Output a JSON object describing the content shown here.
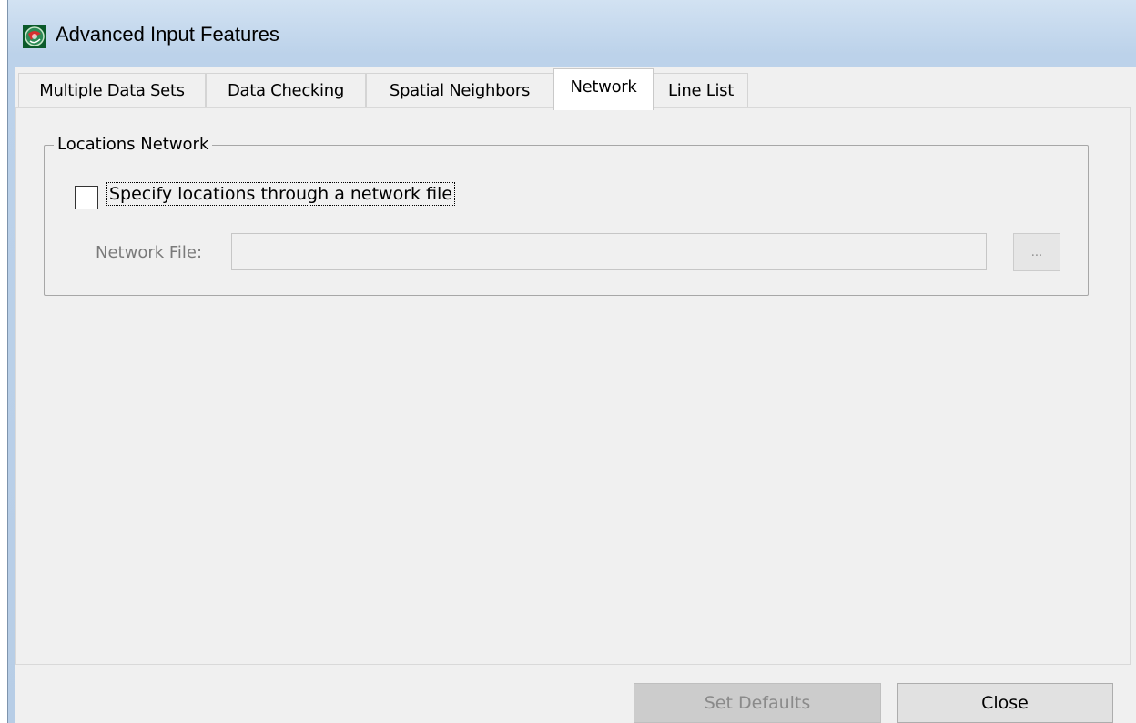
{
  "window": {
    "title": "Advanced Input Features"
  },
  "tabs": [
    {
      "label": "Multiple Data Sets",
      "active": false
    },
    {
      "label": "Data Checking",
      "active": false
    },
    {
      "label": "Spatial Neighbors",
      "active": false
    },
    {
      "label": "Network",
      "active": true
    },
    {
      "label": "Line List",
      "active": false
    }
  ],
  "network_tab": {
    "group_title": "Locations Network",
    "checkbox_label": "Specify locations through a network file",
    "checkbox_checked": false,
    "file_label": "Network File:",
    "file_value": "",
    "browse_label": "..."
  },
  "buttons": {
    "set_defaults": "Set Defaults",
    "close": "Close"
  },
  "colors": {
    "title_bar": "#bcd2ea",
    "panel_bg": "#f0f0f0",
    "disabled_text": "#7a7a7a"
  }
}
